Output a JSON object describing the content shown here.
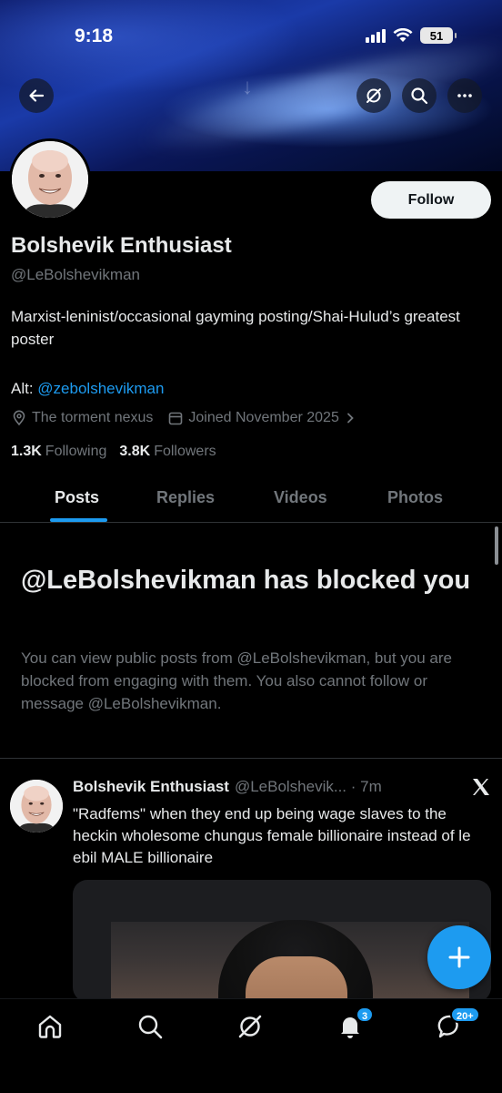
{
  "status_bar": {
    "time": "9:18",
    "battery": "51"
  },
  "profile": {
    "name": "Bolshevik Enthusiast",
    "handle": "@LeBolshevikman",
    "bio": "Marxist-leninist/occasional gayming posting/Shai-Hulud’s greatest poster",
    "alt_label": "Alt:",
    "alt_handle": "@zebolshevikman",
    "location": "The torment nexus",
    "joined": "Joined November 2025",
    "following_count": "1.3K",
    "following_label": "Following",
    "followers_count": "3.8K",
    "followers_label": "Followers",
    "follow_button": "Follow"
  },
  "tabs": [
    {
      "label": "Posts",
      "active": true
    },
    {
      "label": "Replies",
      "active": false
    },
    {
      "label": "Videos",
      "active": false
    },
    {
      "label": "Photos",
      "active": false
    }
  ],
  "blocked_notice": {
    "title": "@LeBolshevikman has blocked you",
    "description": "You can view public posts from @LeBolshevikman, but you are blocked from engaging with them. You also cannot follow or message @LeBolshevikman."
  },
  "post": {
    "author": "Bolshevik Enthusiast",
    "handle_time": "@LeBolshevik... · 7m",
    "text": "\"Radfems\" when they end up being wage slaves to the heckin wholesome chungus female billionaire instead of le ebil MALE billionaire"
  },
  "bottom_nav": {
    "notifications_badge": "3",
    "messages_badge": "20+"
  },
  "colors": {
    "accent": "#1d9bf0",
    "muted": "#71767b",
    "text": "#e7e9ea"
  }
}
